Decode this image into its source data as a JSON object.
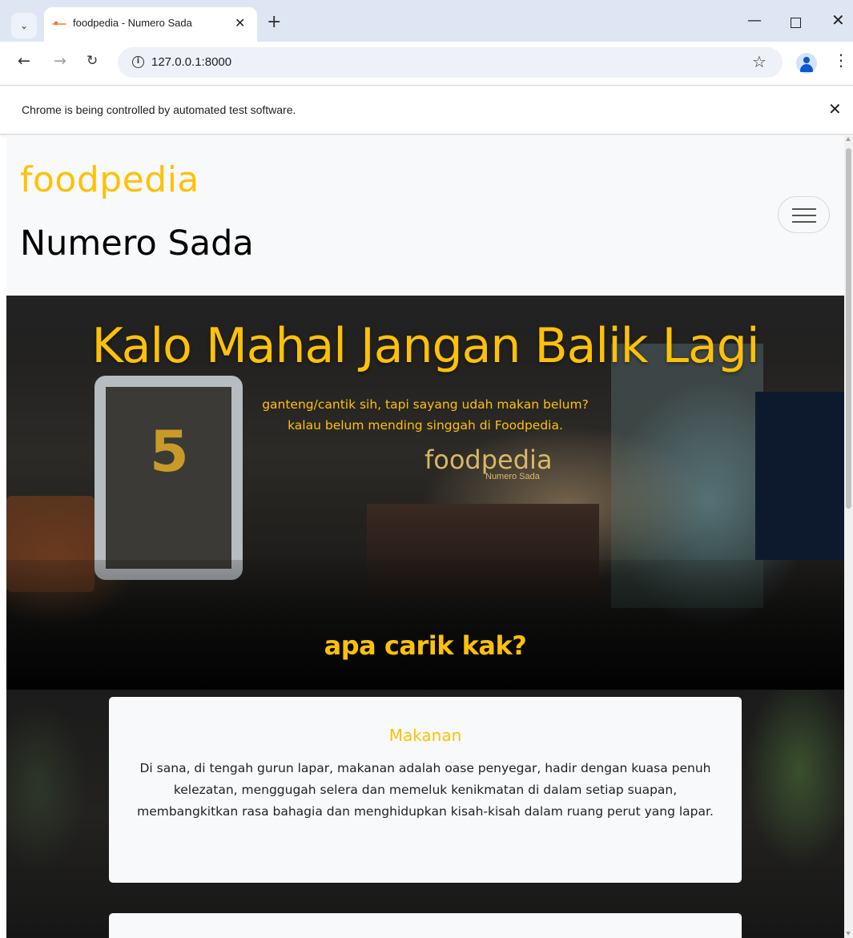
{
  "browser": {
    "tab_title": "foodpedia - Numero Sada",
    "url": "127.0.0.1:8000",
    "infobar_text": "Chrome is being controlled by automated test software.",
    "icons": {
      "tab_menu": "chevron-down-icon",
      "tab_close": "close-icon",
      "new_tab": "plus-icon",
      "minimize": "minimize-icon",
      "maximize": "maximize-icon",
      "window_close": "close-icon",
      "back": "arrow-left-icon",
      "forward": "arrow-right-icon",
      "reload": "reload-icon",
      "site_info": "info-icon",
      "bookmark": "star-icon",
      "profile": "profile-icon",
      "menu": "more-vertical-icon",
      "infobar_close": "close-icon"
    }
  },
  "navbar": {
    "brand": "foodpedia",
    "store_name": "Numero Sada",
    "toggler_icon": "hamburger-menu-icon"
  },
  "hero": {
    "title": "Kalo Mahal Jangan Balik Lagi",
    "subtitle_line1": "ganteng/cantik sih, tapi sayang udah makan belum?",
    "subtitle_line2": "kalau belum mending singgah di Foodpedia.",
    "cta": "apa carik kak?"
  },
  "sections": [
    {
      "title": "Makanan",
      "text": "Di sana, di tengah gurun lapar, makanan adalah oase penyegar, hadir dengan kuasa penuh kelezatan, menggugah selera dan memeluk kenikmatan di dalam setiap suapan, membangkitkan rasa bahagia dan menghidupkan kisah-kisah dalam ruang perut yang lapar."
    }
  ],
  "colors": {
    "accent": "#ffc107",
    "navbar_bg": "#f8f9fa",
    "card_bg": "#f8f9fa",
    "text": "#222222"
  }
}
